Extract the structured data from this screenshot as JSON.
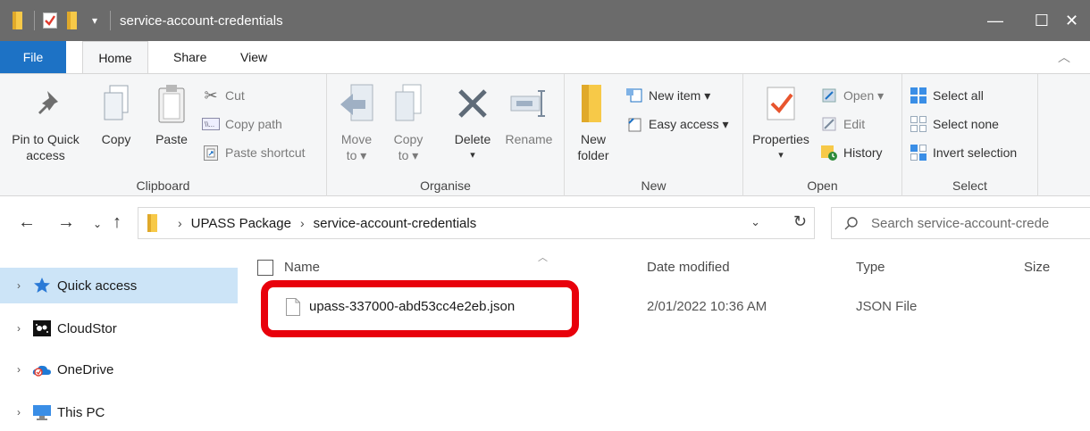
{
  "window": {
    "title": "service-account-credentials",
    "minimize_glyph": "—",
    "maximize_glyph": "☐",
    "close_glyph": "✕"
  },
  "tabs": [
    "File",
    "Home",
    "Share",
    "View"
  ],
  "ribbon": {
    "clipboard": {
      "group_name": "Clipboard",
      "pin_label_1": "Pin to Quick",
      "pin_label_2": "access",
      "copy_label": "Copy",
      "paste_label": "Paste",
      "cut_label": "Cut",
      "copy_path_label": "Copy path",
      "paste_shortcut_label": "Paste shortcut"
    },
    "organise": {
      "group_name": "Organise",
      "move_label_1": "Move",
      "move_label_2": "to ▾",
      "copy_label_1": "Copy",
      "copy_label_2": "to ▾",
      "delete_label": "Delete",
      "delete_arrow": "▾",
      "rename_label": "Rename"
    },
    "new": {
      "group_name": "New",
      "new_folder_1": "New",
      "new_folder_2": "folder",
      "new_item_label": "New item ▾",
      "easy_access_label": "Easy access ▾"
    },
    "open": {
      "group_name": "Open",
      "properties_label": "Properties",
      "properties_arrow": "▾",
      "open_label": "Open ▾",
      "edit_label": "Edit",
      "history_label": "History"
    },
    "select": {
      "group_name": "Select",
      "select_all_label": "Select all",
      "select_none_label": "Select none",
      "invert_label": "Invert selection"
    }
  },
  "address": {
    "crumbs": [
      "UPASS Package",
      "service-account-credentials"
    ],
    "search_placeholder": "Search service-account-crede"
  },
  "navpane": [
    {
      "label": "Quick access",
      "icon": "star-icon",
      "selected": true
    },
    {
      "label": "CloudStor",
      "icon": "cloudstor-icon",
      "selected": false
    },
    {
      "label": "OneDrive",
      "icon": "onedrive-icon",
      "selected": false
    },
    {
      "label": "This PC",
      "icon": "pc-icon",
      "selected": false
    }
  ],
  "columns": {
    "name": "Name",
    "date": "Date modified",
    "type": "Type",
    "size": "Size"
  },
  "files": [
    {
      "name": "upass-337000-abd53cc4e2eb.json",
      "date": "2/01/2022 10:36 AM",
      "type": "JSON File",
      "size": ""
    }
  ],
  "colors": {
    "titlebar": "#6b6b6b",
    "file_tab": "#1d72c5",
    "highlight": "#e8000b",
    "nav_selected": "#cce4f7"
  }
}
